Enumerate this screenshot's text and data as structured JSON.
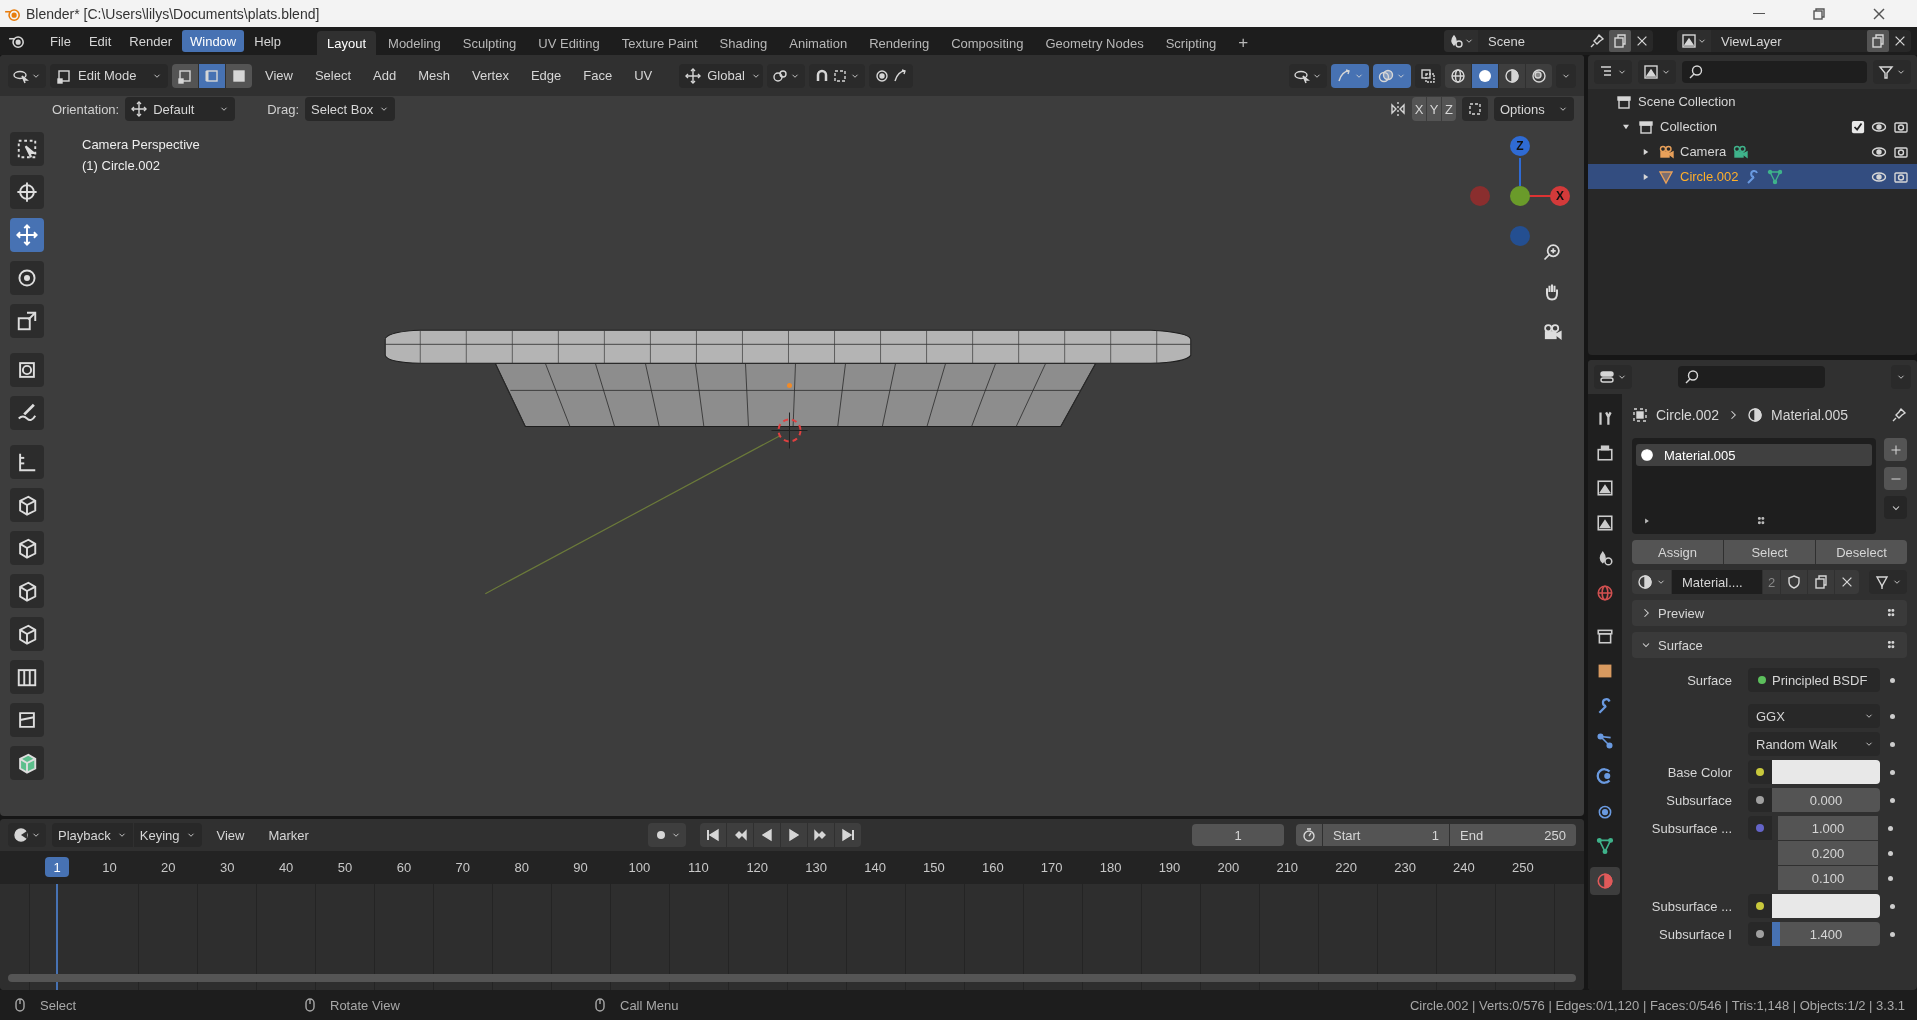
{
  "window": {
    "title": "Blender* [C:\\Users\\lilys\\Documents\\plats.blend]"
  },
  "menubar": {
    "menus": [
      {
        "label": "File",
        "selected": false
      },
      {
        "label": "Edit",
        "selected": false
      },
      {
        "label": "Render",
        "selected": false
      },
      {
        "label": "Window",
        "selected": true
      },
      {
        "label": "Help",
        "selected": false
      }
    ],
    "workspaces": [
      {
        "label": "Layout",
        "selected": true
      },
      {
        "label": "Modeling",
        "selected": false
      },
      {
        "label": "Sculpting",
        "selected": false
      },
      {
        "label": "UV Editing",
        "selected": false
      },
      {
        "label": "Texture Paint",
        "selected": false
      },
      {
        "label": "Shading",
        "selected": false
      },
      {
        "label": "Animation",
        "selected": false
      },
      {
        "label": "Rendering",
        "selected": false
      },
      {
        "label": "Compositing",
        "selected": false
      },
      {
        "label": "Geometry Nodes",
        "selected": false
      },
      {
        "label": "Scripting",
        "selected": false
      }
    ],
    "add_workspace": "+",
    "scene": "Scene",
    "view_layer": "ViewLayer"
  },
  "viewport_header": {
    "mode": "Edit Mode",
    "select_modes": [
      {
        "selected": false
      },
      {
        "selected": true
      },
      {
        "selected": false
      }
    ],
    "menus": [
      "View",
      "Select",
      "Add",
      "Mesh",
      "Vertex",
      "Edge",
      "Face",
      "UV"
    ],
    "orientation": "Global",
    "view_toggles": [
      {
        "on": false
      },
      {
        "on": true
      },
      {
        "on": true
      },
      {
        "on": false
      }
    ],
    "shading_modes": [
      {
        "selected": false
      },
      {
        "selected": true
      },
      {
        "selected": false
      },
      {
        "selected": false
      }
    ]
  },
  "tool_settings": {
    "orientation_label": "Orientation:",
    "orientation": "Default",
    "drag_label": "Drag:",
    "drag": "Select Box",
    "axes": [
      "X",
      "Y",
      "Z"
    ],
    "options": "Options"
  },
  "viewport": {
    "overlay_lines": [
      "Camera Perspective",
      "(1) Circle.002"
    ],
    "gizmo_labels": [
      "Z",
      "X"
    ],
    "tools": [
      {
        "selected": false
      },
      {
        "selected": false
      },
      {
        "selected": true
      },
      {
        "selected": false
      },
      {
        "selected": false
      },
      {
        "selected": false
      },
      {
        "selected": false
      },
      {
        "selected": false
      },
      {
        "selected": false
      },
      {
        "selected": false
      },
      {
        "selected": false
      },
      {
        "selected": false
      },
      {
        "selected": false
      },
      {
        "selected": false
      },
      {
        "selected": false
      }
    ]
  },
  "outliner": {
    "root": "Scene Collection",
    "items": [
      {
        "label": "Collection",
        "expanded": true,
        "checked": true,
        "children": [
          {
            "label": "Camera",
            "expanded": false,
            "selected": false
          },
          {
            "label": "Circle.002",
            "expanded": false,
            "selected": true
          }
        ]
      }
    ]
  },
  "properties": {
    "tabs": [
      {
        "selected": false
      },
      {
        "selected": false
      },
      {
        "selected": false
      },
      {
        "selected": false
      },
      {
        "selected": false
      },
      {
        "selected": false
      },
      {
        "selected": false
      },
      {
        "selected": false
      },
      {
        "selected": false
      },
      {
        "selected": false
      },
      {
        "selected": false
      },
      {
        "selected": false
      },
      {
        "selected": false
      },
      {
        "selected": true
      }
    ],
    "breadcrumb": [
      "Circle.002",
      "Material.005"
    ],
    "slots": [
      {
        "label": "Material.005",
        "selected": true
      }
    ],
    "slot_buttons": [
      "Assign",
      "Select",
      "Deselect"
    ],
    "material": "Material....",
    "users": "2",
    "panels": [
      {
        "label": "Preview",
        "expanded": false
      },
      {
        "label": "Surface",
        "expanded": true
      }
    ],
    "fields": [
      {
        "kind": "shader",
        "label": "Surface",
        "value": "Principled BSDF",
        "color": "#5cbf5c"
      },
      {
        "kind": "dropdown",
        "value": "GGX"
      },
      {
        "kind": "dropdown",
        "value": "Random Walk"
      },
      {
        "kind": "color",
        "label": "Base Color",
        "color": "#c8c83c"
      },
      {
        "kind": "number",
        "label": "Subsurface",
        "value": "0.000",
        "color": "#a0a0a0"
      },
      {
        "kind": "vector",
        "label": "Subsurface ...",
        "values": [
          "1.000",
          "0.200",
          "0.100"
        ],
        "color": "#6464c8"
      },
      {
        "kind": "color",
        "label": "Subsurface ...",
        "color": "#c8c83c"
      },
      {
        "kind": "slider",
        "label": "Subsurface I",
        "value": "1.400",
        "level": 0.07,
        "color": "#a0a0a0"
      }
    ]
  },
  "timeline": {
    "menus": [
      "Playback",
      "Keying",
      "View",
      "Marker"
    ],
    "current_frame": "1",
    "start_label": "Start",
    "start": "1",
    "end_label": "End",
    "end": "250",
    "marker": "1",
    "ruler": [
      "10",
      "20",
      "30",
      "40",
      "50",
      "60",
      "70",
      "80",
      "90",
      "100",
      "110",
      "120",
      "130",
      "140",
      "150",
      "160",
      "170",
      "180",
      "190",
      "200",
      "210",
      "220",
      "230",
      "240",
      "250"
    ]
  },
  "status_bar": {
    "hints": [
      "Select",
      "Rotate View",
      "Call Menu"
    ],
    "stats": "Circle.002 | Verts:0/576 | Edges:0/1,120 | Faces:0/546 | Tris:1,148 | Objects:1/2 | 3.3.1"
  }
}
